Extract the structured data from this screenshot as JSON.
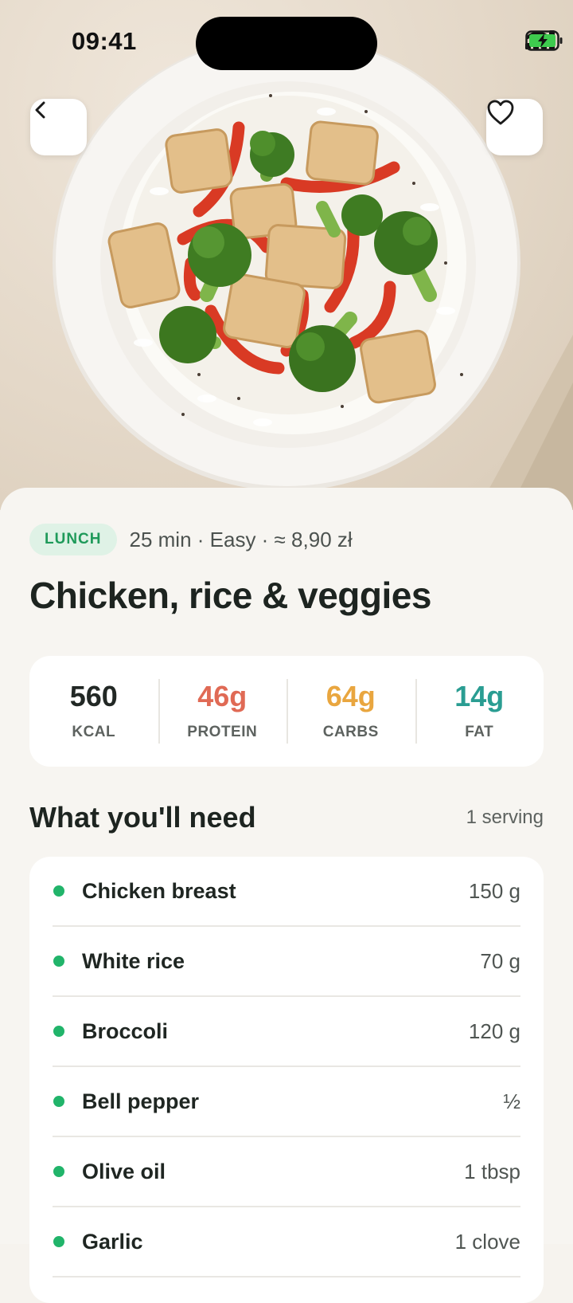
{
  "status": {
    "time": "09:41"
  },
  "hero": {
    "image": "chicken-rice-veggies-photo"
  },
  "tag": "LUNCH",
  "meta": "25 min · Easy · ≈ 8,90 zł",
  "title": "Chicken, rice & veggies",
  "nutrition": [
    {
      "value": "560",
      "label": "KCAL",
      "color": "#222825"
    },
    {
      "value": "46g",
      "label": "PROTEIN",
      "color": "#e06a55"
    },
    {
      "value": "64g",
      "label": "CARBS",
      "color": "#e9a63f"
    },
    {
      "value": "14g",
      "label": "FAT",
      "color": "#2a9d92"
    }
  ],
  "ingredients_section": {
    "title": "What you'll need",
    "servings": "1 serving"
  },
  "ingredients": [
    {
      "name": "Chicken breast",
      "qty": "150 g"
    },
    {
      "name": "White rice",
      "qty": "70 g"
    },
    {
      "name": "Broccoli",
      "qty": "120 g"
    },
    {
      "name": "Bell pepper",
      "qty": "½"
    },
    {
      "name": "Olive oil",
      "qty": "1 tbsp"
    },
    {
      "name": "Garlic",
      "qty": "1 clove"
    }
  ],
  "icons": {
    "back": "chevron-left-icon",
    "favorite": "heart-icon"
  },
  "colors": {
    "accent": "#21b46a",
    "tag_bg": "#dff2e6"
  }
}
